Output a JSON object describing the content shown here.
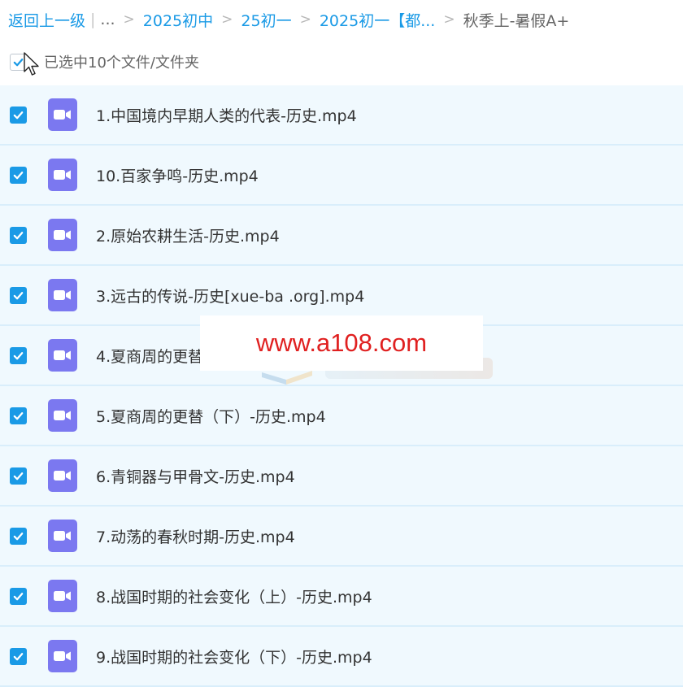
{
  "breadcrumb": {
    "back_label": "返回上一级",
    "pipe": "|",
    "ellipsis": "...",
    "separator": ">",
    "items": [
      "2025初中",
      "25初一",
      "2025初一【都..."
    ],
    "current": "秋季上-暑假A+"
  },
  "selection": {
    "label": "已选中10个文件/文件夹"
  },
  "files": [
    {
      "name": "1.中国境内早期人类的代表-历史.mp4",
      "checked": true
    },
    {
      "name": "10.百家争鸣-历史.mp4",
      "checked": true
    },
    {
      "name": "2.原始农耕生活-历史.mp4",
      "checked": true
    },
    {
      "name": "3.远古的传说-历史[xue-ba .org].mp4",
      "checked": true
    },
    {
      "name": "4.夏商周的更替",
      "checked": true
    },
    {
      "name": "5.夏商周的更替（下）-历史.mp4",
      "checked": true
    },
    {
      "name": "6.青铜器与甲骨文-历史.mp4",
      "checked": true
    },
    {
      "name": "7.动荡的春秋时期-历史.mp4",
      "checked": true
    },
    {
      "name": "8.战国时期的社会变化（上）-历史.mp4",
      "checked": true
    },
    {
      "name": "9.战国时期的社会变化（下）-历史.mp4",
      "checked": true
    }
  ],
  "watermark": {
    "text": "www.a108.com"
  },
  "colors": {
    "accent": "#1a9ae6",
    "row_background": "#f0f9fe",
    "row_divider": "#d9eefb",
    "video_icon": "#7b78f0",
    "watermark_text": "#e02020"
  },
  "icons": {
    "checkbox": "checkmark-icon",
    "file": "video-file-icon",
    "pointer": "mouse-cursor-icon"
  }
}
